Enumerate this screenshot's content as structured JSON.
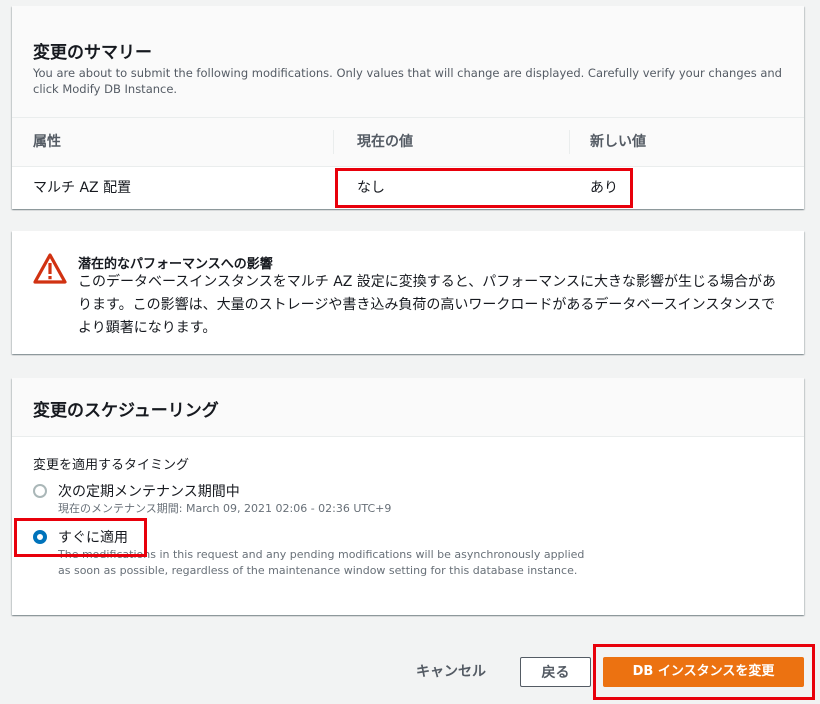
{
  "summary": {
    "title": "変更のサマリー",
    "description": "You are about to submit the following modifications. Only values that will change are displayed. Carefully verify your changes and click Modify DB Instance.",
    "columns": [
      "属性",
      "現在の値",
      "新しい値"
    ],
    "rows": [
      {
        "attribute": "マルチ AZ 配置",
        "current": "なし",
        "new": "あり"
      }
    ]
  },
  "warning": {
    "icon": "warning-triangle-icon",
    "title": "潜在的なパフォーマンスへの影響",
    "body": "このデータベースインスタンスをマルチ AZ 設定に変換すると、パフォーマンスに大きな影響が生じる場合があります。この影響は、大量のストレージや書き込み負荷の高いワークロードがあるデータベースインスタンスでより顕著になります。"
  },
  "scheduling": {
    "title": "変更のスケジューリング",
    "timing_label": "変更を適用するタイミング",
    "options": [
      {
        "label": "次の定期メンテナンス期間中",
        "description": "現在のメンテナンス期間: March 09, 2021 02:06 - 02:36 UTC+9",
        "selected": false
      },
      {
        "label": "すぐに適用",
        "description": "The modifications in this request and any pending modifications will be asynchronously applied as soon as possible, regardless of the maintenance window setting for this database instance.",
        "selected": true
      }
    ]
  },
  "footer": {
    "cancel_label": "キャンセル",
    "back_label": "戻る",
    "submit_label": "DB インスタンスを変更"
  },
  "colors": {
    "primary": "#ec7211",
    "selected_radio": "#0073bb",
    "warning": "#d13212",
    "highlight": "#e8000b"
  }
}
